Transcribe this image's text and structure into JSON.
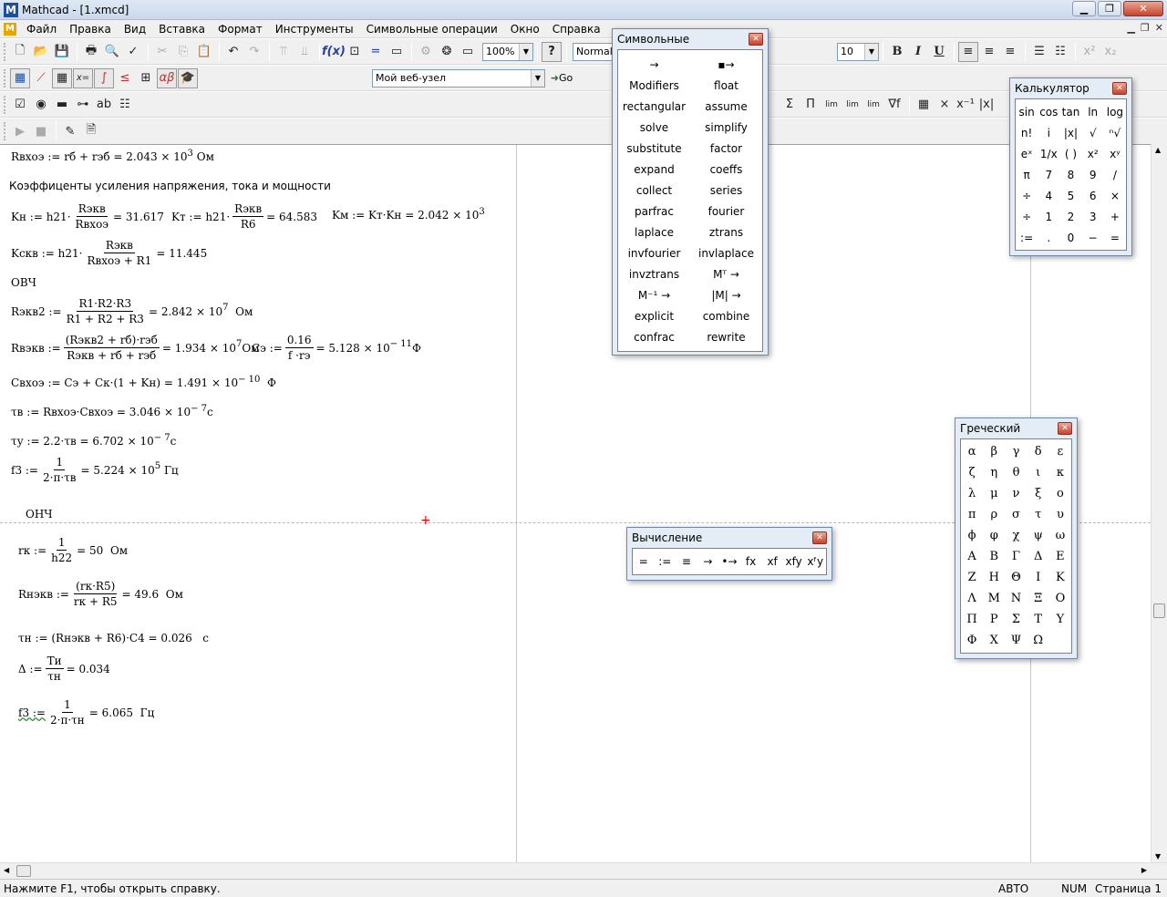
{
  "window": {
    "title": "Mathcad - [1.xmcd]",
    "app_icon": "M"
  },
  "menu": [
    "Файл",
    "Правка",
    "Вид",
    "Вставка",
    "Формат",
    "Инструменты",
    "Символьные операции",
    "Окно",
    "Справка"
  ],
  "toolbar": {
    "zoom": "100%",
    "style": "Normal",
    "font_size": "10",
    "web": "Мой веб-узел",
    "go": "Go",
    "bold": "B",
    "italic": "I",
    "underline": "U"
  },
  "doc": {
    "rvhoe": "Rвхоэ := rб + rэб = 2.043 × 10",
    "rvhoe_exp": "3",
    "rvhoe_unit": "Ом",
    "heading": "Коэффиценты усиления напряжения, тока и мощности",
    "kn_lhs": "Kн := h21·",
    "kn_num": "Rэкв",
    "kn_den": "Rвхоэ",
    "kn_val": "= 31.617",
    "kt_lhs": "Kт := h21·",
    "kt_num": "Rэкв",
    "kt_den": "R6",
    "kt_val": "= 64.583",
    "km": "Kм := Kт·Kн = 2.042 × 10",
    "km_exp": "3",
    "kskv_lhs": "Kскв := h21·",
    "kskv_num": "Rэкв",
    "kskv_den": "Rвхоэ + R1",
    "kskv_val": "= 11.445",
    "ovch": "ОВЧ",
    "rekv2_lhs": "Rэкв2 :=",
    "rekv2_num": "R1·R2·R3",
    "rekv2_den": "R1 + R2 + R3",
    "rekv2_val": "= 2.842 × 10",
    "rekv2_exp": "7",
    "rekv2_unit": "Ом",
    "rekv_lhs": "Rвэкв :=",
    "rekv_num": "(Rэкв2 + rб)·rэб",
    "rekv_den": "Rэкв + rб + rэб",
    "rekv_val": "= 1.934 × 10",
    "rekv_exp": "7",
    "rekv_unit": "Ом",
    "ce_lhs": "Cэ :=",
    "ce_num": "0.16",
    "ce_den": "f ·rэ",
    "ce_val": "= 5.128 × 10",
    "ce_exp": "− 11",
    "ce_unit": "Ф",
    "cvhoe": "Cвхоэ := Cэ + Cк·(1 + Kн) = 1.491 × 10",
    "cvhoe_exp": "− 10",
    "cvhoe_unit": "Ф",
    "tv": "τв := Rвхоэ·Cвхоэ = 3.046 × 10",
    "tv_exp": "− 7",
    "tv_unit": "c",
    "ty": "τу := 2.2·τв = 6.702 × 10",
    "ty_exp": "− 7",
    "ty_unit": "c",
    "f3_lhs": "f3 :=",
    "f3_num": "1",
    "f3_den": "2·π·τв",
    "f3_val": "= 5.224 × 10",
    "f3_exp": "5",
    "f3_unit": "Гц",
    "onch": "ОНЧ",
    "rk_lhs": "rк :=",
    "rk_num": "1",
    "rk_den": "h22",
    "rk_val": "= 50",
    "rk_unit": "Ом",
    "rnekv_lhs": "Rнэкв :=",
    "rnekv_num": "(rк·R5)",
    "rnekv_den": "rк + R5",
    "rnekv_val": "= 49.6",
    "rnekv_unit": "Ом",
    "tn": "τн := (Rнэкв + R6)·C4 = 0.026",
    "tn_unit": "c",
    "delta_lhs": "Δ :=",
    "delta_num": "Tи",
    "delta_den": "τн",
    "delta_val": "= 0.034",
    "fn_lhs": "f3 :=",
    "fn_num": "1",
    "fn_den": "2·π·τн",
    "fn_val": "= 6.065",
    "fn_unit": "Гц"
  },
  "symbolic": {
    "title": "Символьные",
    "items": [
      "→",
      "▪→",
      "Modifiers",
      "float",
      "rectangular",
      "assume",
      "solve",
      "simplify",
      "substitute",
      "factor",
      "expand",
      "coeffs",
      "collect",
      "series",
      "parfrac",
      "fourier",
      "laplace",
      "ztrans",
      "invfourier",
      "invlaplace",
      "invztrans",
      "Mᵀ →",
      "M⁻¹ →",
      "|M| →",
      "explicit",
      "combine",
      "confrac",
      "rewrite"
    ]
  },
  "calculator": {
    "title": "Калькулятор",
    "items": [
      "sin",
      "cos",
      "tan",
      "ln",
      "log",
      "n!",
      "i",
      "|x|",
      "√",
      "ⁿ√",
      "eˣ",
      "1/x",
      "( )",
      "x²",
      "xʸ",
      "π",
      "7",
      "8",
      "9",
      "/",
      "÷",
      "4",
      "5",
      "6",
      "×",
      "÷",
      "1",
      "2",
      "3",
      "+",
      ":=",
      ".",
      "0",
      "−",
      "="
    ]
  },
  "greek": {
    "title": "Греческий",
    "items": [
      "α",
      "β",
      "γ",
      "δ",
      "ε",
      "ζ",
      "η",
      "θ",
      "ι",
      "κ",
      "λ",
      "μ",
      "ν",
      "ξ",
      "ο",
      "π",
      "ρ",
      "σ",
      "τ",
      "υ",
      "ϕ",
      "φ",
      "χ",
      "ψ",
      "ω",
      "Α",
      "Β",
      "Γ",
      "Δ",
      "Ε",
      "Ζ",
      "Η",
      "Θ",
      "Ι",
      "Κ",
      "Λ",
      "Μ",
      "Ν",
      "Ξ",
      "Ο",
      "Π",
      "Ρ",
      "Σ",
      "Τ",
      "Υ",
      "Φ",
      "Χ",
      "Ψ",
      "Ω"
    ]
  },
  "evaluation": {
    "title": "Вычисление",
    "items": [
      "=",
      ":=",
      "≡",
      "→",
      "•→",
      "fx",
      "xf",
      "xfy",
      "xᶠy"
    ]
  },
  "status": {
    "help": "Нажмите F1, чтобы открыть справку.",
    "mode": "АВТО",
    "num": "NUM",
    "page": "Страница 1"
  }
}
